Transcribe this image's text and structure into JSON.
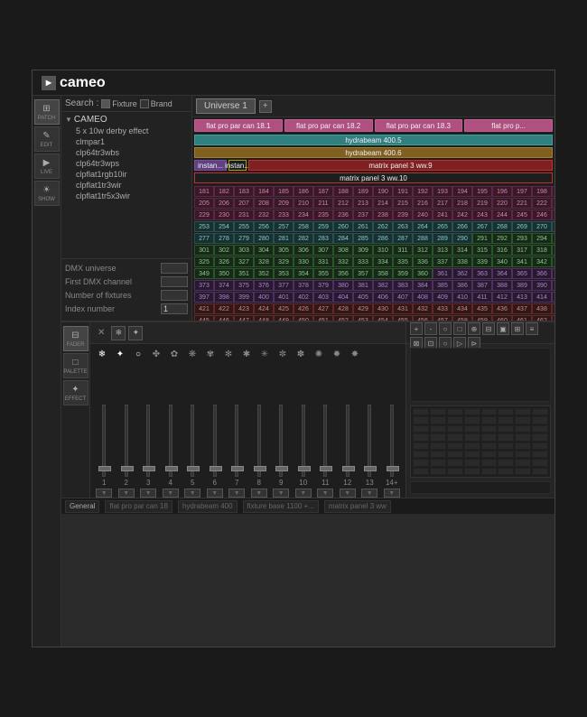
{
  "app": {
    "title": "cameo",
    "logo_symbol": "▶"
  },
  "sidebar": {
    "buttons": [
      {
        "id": "patch",
        "label": "PATCH",
        "icon": "⊞",
        "active": true
      },
      {
        "id": "edit",
        "label": "EDIT",
        "icon": "✎",
        "active": false
      },
      {
        "id": "live",
        "label": "LIVE",
        "icon": "▶",
        "active": false
      },
      {
        "id": "show",
        "label": "SHOW",
        "icon": "☀",
        "active": false
      }
    ]
  },
  "fixture_panel": {
    "search_label": "Search :",
    "fixture_cb": "Fixture",
    "brand_cb": "Brand",
    "root": "CAMEO",
    "items": [
      "5 x 10w derby effect",
      "clmpar1",
      "clp64tr3wbs",
      "clp64tr3wps",
      "clpflat1rgb10ir",
      "clpflat1tr3wir",
      "clpflat1tr5x3wir"
    ],
    "controls": [
      {
        "label": "DMX universe",
        "value": ""
      },
      {
        "label": "First DMX channel",
        "value": ""
      },
      {
        "label": "Number of fixtures",
        "value": ""
      },
      {
        "label": "Index number",
        "value": "1"
      }
    ]
  },
  "universe": {
    "tab_label": "Universe 1",
    "add_btn": "+",
    "fixtures": [
      {
        "label": "flat pro par can 18.1",
        "color": "pink",
        "span": 1
      },
      {
        "label": "flat pro par can 18.2",
        "color": "pink",
        "span": 1
      },
      {
        "label": "flat pro par can 18.3",
        "color": "pink",
        "span": 1
      },
      {
        "label": "flat pro p...",
        "color": "pink",
        "span": 1
      }
    ],
    "hydra1": "hydrabeam 400.5",
    "hydra2": "hydrabeam 400.6",
    "instan1": "instan...",
    "instan2": "instan...",
    "matrix1": "matrix panel 3 ww.9",
    "matrix2": "matrix panel 3 ww.10"
  },
  "dmx_grid": {
    "start": 181,
    "rows": 17,
    "cols": 24
  },
  "fader": {
    "close_btn": "✕",
    "icons": [
      "❄",
      "✦",
      "○",
      "✤",
      "✿",
      "❋",
      "✾",
      "✻",
      "✱",
      "✳",
      "✼",
      "✽",
      "✺",
      "✹",
      "✸",
      "✷"
    ],
    "numbers": [
      1,
      2,
      3,
      4,
      5,
      6,
      7,
      8,
      9,
      10,
      11,
      12,
      13,
      "14+"
    ],
    "palette_label": "PALETTE",
    "effect_label": "EFFECT"
  },
  "right_toolbar": {
    "buttons": [
      "+zoom",
      "-zoom",
      "○",
      "□",
      "⊕",
      "⊟",
      "▣",
      "⊞",
      "≡",
      "⊠",
      "⊡",
      "○",
      "▷",
      "⊳",
      "▸",
      "⊕",
      "▾"
    ]
  },
  "status_bar": {
    "items": [
      "General",
      "flat pro par can 18",
      "hydrabeam 400",
      "fixture base 1100 +...",
      "matrix panel 3 ww"
    ]
  }
}
